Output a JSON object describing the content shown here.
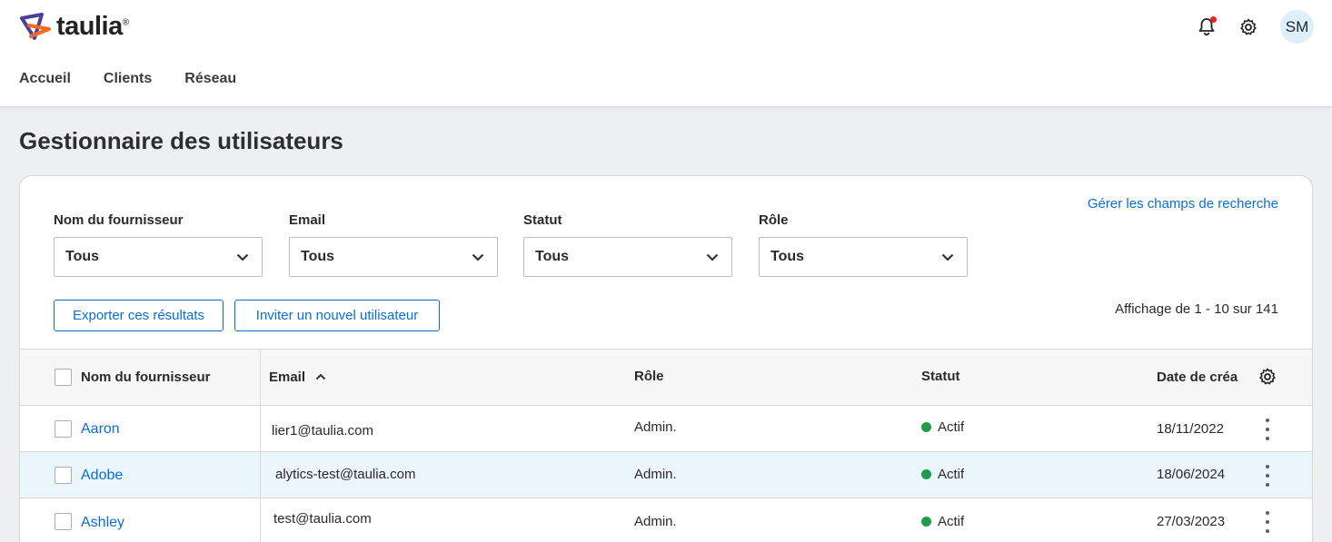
{
  "brand": {
    "name": "taulia",
    "tm": "®"
  },
  "nav": [
    "Accueil",
    "Clients",
    "Réseau"
  ],
  "user": {
    "initials": "SM"
  },
  "page_title": "Gestionnaire des utilisateurs",
  "manage_link": "Gérer les champs de recherche",
  "filters": [
    {
      "label": "Nom du fournisseur",
      "value": "Tous"
    },
    {
      "label": "Email",
      "value": "Tous"
    },
    {
      "label": "Statut",
      "value": "Tous"
    },
    {
      "label": "Rôle",
      "value": "Tous"
    }
  ],
  "actions": {
    "export": "Exporter ces résultats",
    "invite": "Inviter un nouvel utilisateur"
  },
  "results_text": "Affichage de 1 - 10 sur 141",
  "columns": {
    "supplier": "Nom du fournisseur",
    "email": "Email",
    "role": "Rôle",
    "status": "Statut",
    "date": "Date de créa"
  },
  "rows": [
    {
      "supplier": "Aaron",
      "email": "lier1@taulia.com",
      "role": "Admin.",
      "status": "Actif",
      "date": "18/11/2022",
      "selected": false
    },
    {
      "supplier": "Adobe",
      "email": "alytics-test@taulia.com",
      "role": "Admin.",
      "status": "Actif",
      "date": "18/06/2024",
      "selected": true
    },
    {
      "supplier": "Ashley",
      "email": "test@taulia.com",
      "role": "Admin.",
      "status": "Actif",
      "date": "27/03/2023",
      "selected": false
    }
  ],
  "colors": {
    "accent": "#0a6ed1",
    "status_active": "#1e9c4a",
    "notification": "#e0242b",
    "logo_orange": "#f26b21",
    "logo_purple": "#4b3f9a"
  }
}
